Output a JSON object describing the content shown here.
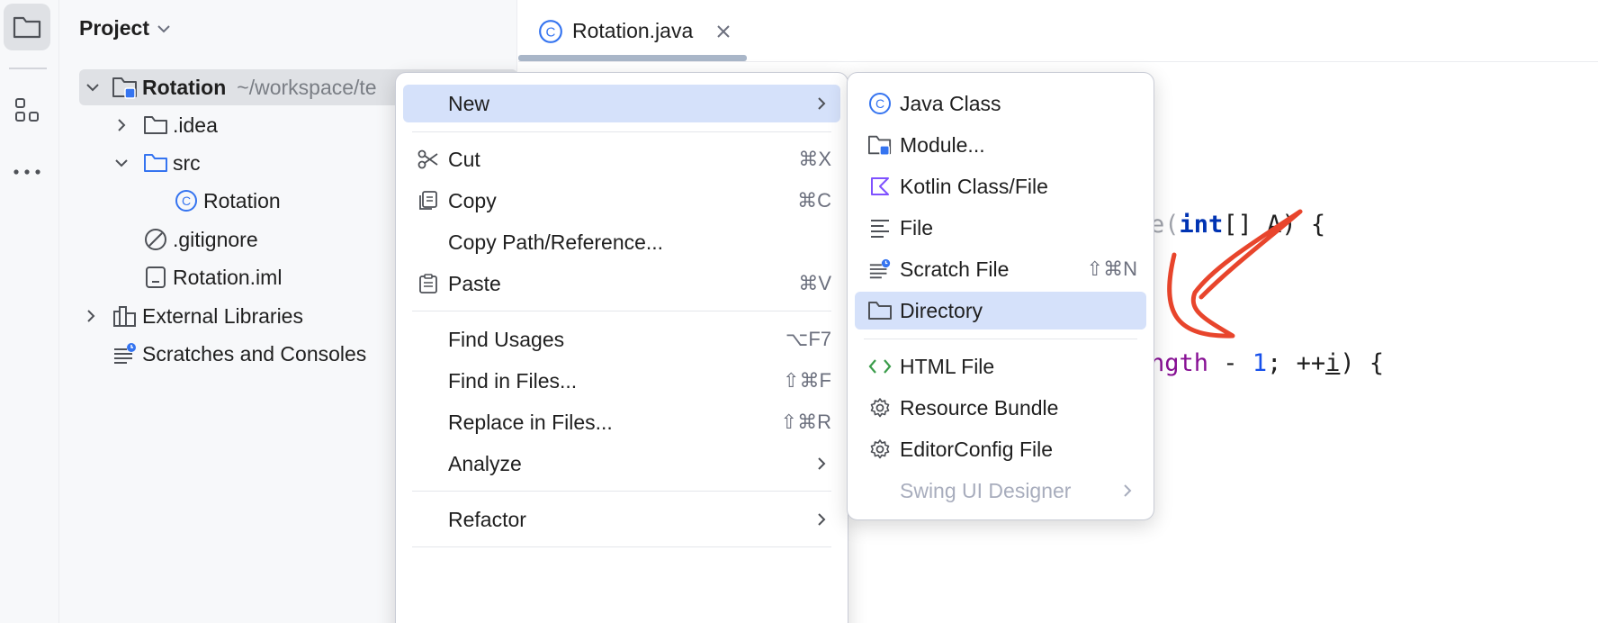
{
  "toolstrip": {
    "icons": [
      "folder-icon",
      "structure-icon",
      "more-icon"
    ]
  },
  "project": {
    "title": "Project",
    "tree": [
      {
        "label": "Rotation",
        "hint": "~/workspace/te",
        "icon": "module-folder-icon",
        "expanded": true
      },
      {
        "label": ".idea",
        "icon": "folder-icon",
        "expanded": false
      },
      {
        "label": "src",
        "icon": "folder-icon",
        "expanded": true
      },
      {
        "label": "Rotation",
        "icon": "java-class-icon"
      },
      {
        "label": ".gitignore",
        "icon": "ignored-file-icon"
      },
      {
        "label": "Rotation.iml",
        "icon": "iml-file-icon"
      },
      {
        "label": "External Libraries",
        "icon": "library-icon",
        "expanded": false
      },
      {
        "label": "Scratches and Consoles",
        "icon": "scratch-icon"
      }
    ]
  },
  "editor": {
    "tab_label": "Rotation.java",
    "code_line1": {
      "fn_tail": "e(",
      "kw": "int",
      "rest": "[] A) {"
    },
    "code_line2": {
      "fn_tail": "ngth",
      "op": " - ",
      "num": "1",
      "mid": "; ++",
      "var": "i",
      "end": ") {"
    }
  },
  "context_menu": {
    "items": [
      {
        "label": "New",
        "submenu": true,
        "highlighted": true
      },
      {
        "label": "Cut",
        "shortcut": "⌘X",
        "icon": "scissors-icon"
      },
      {
        "label": "Copy",
        "shortcut": "⌘C",
        "icon": "copy-icon"
      },
      {
        "label": "Copy Path/Reference..."
      },
      {
        "label": "Paste",
        "shortcut": "⌘V",
        "icon": "paste-icon"
      },
      {
        "label": "Find Usages",
        "shortcut": "⌥F7"
      },
      {
        "label": "Find in Files...",
        "shortcut": "⇧⌘F"
      },
      {
        "label": "Replace in Files...",
        "shortcut": "⇧⌘R"
      },
      {
        "label": "Analyze",
        "submenu": true
      },
      {
        "label": "Refactor",
        "submenu": true
      }
    ]
  },
  "new_submenu": {
    "items": [
      {
        "label": "Java Class",
        "icon": "java-class-icon"
      },
      {
        "label": "Module...",
        "icon": "module-folder-icon"
      },
      {
        "label": "Kotlin Class/File",
        "icon": "kotlin-icon"
      },
      {
        "label": "File",
        "icon": "file-lines-icon"
      },
      {
        "label": "Scratch File",
        "shortcut": "⇧⌘N",
        "icon": "scratch-icon"
      },
      {
        "label": "Directory",
        "icon": "folder-icon",
        "highlighted": true
      },
      {
        "label": "HTML File",
        "icon": "html-icon"
      },
      {
        "label": "Resource Bundle",
        "icon": "gear-icon"
      },
      {
        "label": "EditorConfig File",
        "icon": "gear-icon"
      },
      {
        "label": "Swing UI Designer",
        "submenu": true,
        "disabled": true
      }
    ]
  },
  "colors": {
    "highlight": "#d5e1fa",
    "annotation_stroke": "#e8452c",
    "java_class": "#3574f0"
  }
}
